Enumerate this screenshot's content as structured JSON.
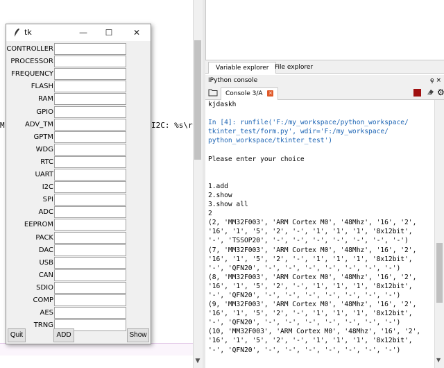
{
  "editor": {
    "code_fragment": "I2C: %s\\r",
    "left_fragment": "M"
  },
  "explorer_tabs": [
    "Variable explorer",
    "File explorer"
  ],
  "ipython": {
    "title": "IPython console",
    "title_controls": "ȩ ×",
    "tab_label": "Console 3/A",
    "tab_close": "×"
  },
  "console_lines": [
    {
      "t": "kjdaskh",
      "c": ""
    },
    {
      "t": "",
      "c": "blank"
    },
    {
      "t": "In [4]: runfile('F:/my_workspace/python_workspace/",
      "c": "prompt"
    },
    {
      "t": "tkinter_test/form.py', wdir='F:/my_workspace/",
      "c": "str"
    },
    {
      "t": "python_workspace/tkinter_test')",
      "c": "str"
    },
    {
      "t": "",
      "c": "blank"
    },
    {
      "t": "Please enter your choice",
      "c": ""
    },
    {
      "t": "",
      "c": "blank"
    },
    {
      "t": "",
      "c": "blank"
    },
    {
      "t": "1.add",
      "c": ""
    },
    {
      "t": "2.show",
      "c": ""
    },
    {
      "t": "3.show all",
      "c": ""
    },
    {
      "t": "2",
      "c": ""
    },
    {
      "t": "(2, 'MM32F003', 'ARM Cortex M0', '48Mhz', '16', '2',",
      "c": ""
    },
    {
      "t": "'16', '1', '5', '2', '-', '1', '1', '1', '8x12bit',",
      "c": ""
    },
    {
      "t": "'-', 'TSSOP20', '-', '-', '-', '-', '-', '-', '-')",
      "c": ""
    },
    {
      "t": "(7, 'MM32F003', 'ARM Cortex M0', '48Mhz', '16', '2',",
      "c": ""
    },
    {
      "t": "'16', '1', '5', '2', '-', '1', '1', '1', '8x12bit',",
      "c": ""
    },
    {
      "t": "'-', 'QFN20', '-', '-', '-', '-', '-', '-', '-')",
      "c": ""
    },
    {
      "t": "(8, 'MM32F003', 'ARM Cortex M0', '48Mhz', '16', '2',",
      "c": ""
    },
    {
      "t": "'16', '1', '5', '2', '-', '1', '1', '1', '8x12bit',",
      "c": ""
    },
    {
      "t": "'-', 'QFN20', '-', '-', '-', '-', '-', '-', '-')",
      "c": ""
    },
    {
      "t": "(9, 'MM32F003', 'ARM Cortex M0', '48Mhz', '16', '2',",
      "c": ""
    },
    {
      "t": "'16', '1', '5', '2', '-', '1', '1', '1', '8x12bit',",
      "c": ""
    },
    {
      "t": "'-', 'QFN20', '-', '-', '-', '-', '-', '-', '-')",
      "c": ""
    },
    {
      "t": "(10, 'MM32F003', 'ARM Cortex M0', '48Mhz', '16', '2',",
      "c": ""
    },
    {
      "t": "'16', '1', '5', '2', '-', '1', '1', '1', '8x12bit',",
      "c": ""
    },
    {
      "t": "'-', 'QFN20', '-', '-', '-', '-', '-', '-', '-')",
      "c": ""
    }
  ],
  "tk": {
    "title": "tk",
    "minimize": "—",
    "maximize": "☐",
    "close": "✕",
    "fields": [
      {
        "label": "CONTROLLER",
        "value": ""
      },
      {
        "label": "PROCESSOR",
        "value": ""
      },
      {
        "label": "FREQUENCY",
        "value": ""
      },
      {
        "label": "FLASH",
        "value": ""
      },
      {
        "label": "RAM",
        "value": ""
      },
      {
        "label": "GPIO",
        "value": ""
      },
      {
        "label": "ADV_TM",
        "value": ""
      },
      {
        "label": "GPTM",
        "value": ""
      },
      {
        "label": "WDG",
        "value": ""
      },
      {
        "label": "RTC",
        "value": ""
      },
      {
        "label": "UART",
        "value": ""
      },
      {
        "label": "I2C",
        "value": ""
      },
      {
        "label": "SPI",
        "value": ""
      },
      {
        "label": "ADC",
        "value": ""
      },
      {
        "label": "EEPROM",
        "value": ""
      },
      {
        "label": "PACK",
        "value": ""
      },
      {
        "label": "DAC",
        "value": ""
      },
      {
        "label": "USB",
        "value": ""
      },
      {
        "label": "CAN",
        "value": ""
      },
      {
        "label": "SDIO",
        "value": ""
      },
      {
        "label": "COMP",
        "value": ""
      },
      {
        "label": "AES",
        "value": ""
      },
      {
        "label": "TRNG",
        "value": ""
      }
    ],
    "buttons": {
      "quit": "Quit",
      "add": "ADD",
      "show": "Show"
    }
  },
  "colors": {
    "console_prompt": "#1c64b4",
    "stop_button": "#a01010",
    "tab_close": "#e05a2a"
  }
}
